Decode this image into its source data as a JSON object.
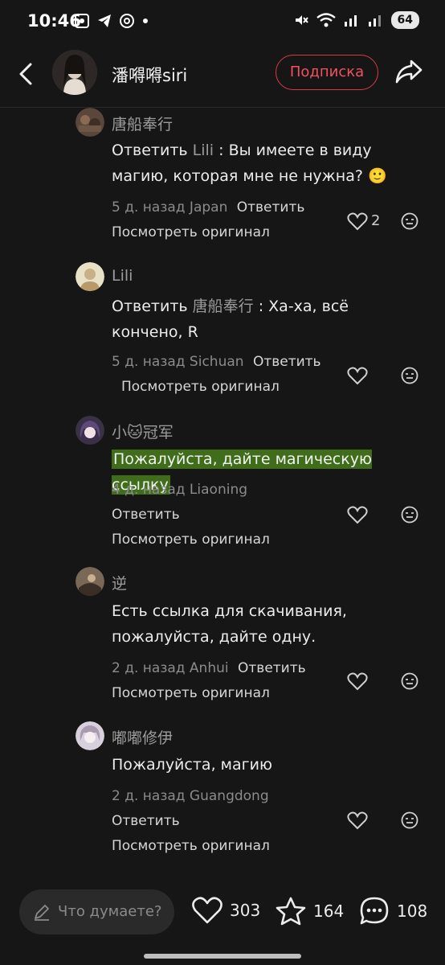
{
  "status_bar": {
    "time": "10:46",
    "battery": "64"
  },
  "header": {
    "user_name": "潘嘚嘚siri",
    "follow_label": "Подписка"
  },
  "comments": [
    {
      "name": "唐船奉行",
      "reply_label": "Ответить",
      "mention": "Lili",
      "text": "Вы имеете в виду магию, которая мне не нужна?",
      "emoji": "🙂",
      "meta": "5 д. назад Japan",
      "reply_link": "Ответить",
      "original": "Посмотреть оригинал",
      "likes": "2"
    },
    {
      "name": "Lili",
      "reply_label": "Ответить",
      "mention": "唐船奉行",
      "text": "Ха-ха, всё кончено, R",
      "meta": "5 д. назад Sichuan",
      "reply_link": "Ответить",
      "original": "Посмотреть оригинал"
    },
    {
      "name": "小🐱冠军",
      "text": "Пожалуйста, дайте магическую ссылку",
      "meta": "4 д. назад Liaoning",
      "reply_link": "Ответить",
      "original": "Посмотреть оригинал"
    },
    {
      "name": "逆",
      "text": "Есть ссылка для скачивания, пожалуйста, дайте одну.",
      "meta": "2 д. назад Anhui",
      "reply_link": "Ответить",
      "original": "Посмотреть оригинал"
    },
    {
      "name": "嘟嘟修伊",
      "text": "Пожалуйста, магию",
      "meta": "2 д. назад Guangdong",
      "reply_link": "Ответить",
      "original": "Посмотреть оригинал"
    }
  ],
  "bottom_bar": {
    "placeholder": "Что думаете?",
    "likes": "303",
    "favorites": "164",
    "comments": "108"
  },
  "colors": {
    "accent": "#f25160",
    "highlight": "#3f6d19",
    "background": "#161616"
  }
}
